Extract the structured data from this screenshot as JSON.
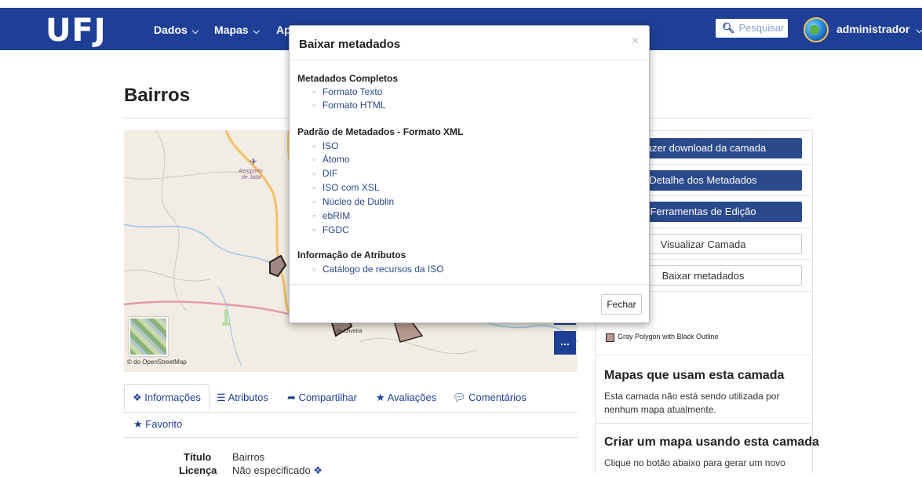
{
  "header": {
    "logo": "UFJ",
    "nav": [
      {
        "label": "Dados"
      },
      {
        "label": "Mapas"
      },
      {
        "label": "Ap"
      }
    ],
    "search_placeholder": "Pesquisar",
    "username": "administrador"
  },
  "page": {
    "title": "Bairros",
    "map_labels": {
      "airport": "Aeroporto de Jataí",
      "place": "de Oliveira",
      "credit": "© do OpenStreetMap"
    },
    "map_more_button": "...",
    "tabs": [
      {
        "icon": "info-icon",
        "label": "Informações"
      },
      {
        "icon": "list-icon",
        "label": "Atributos"
      },
      {
        "icon": "share-icon",
        "label": "Compartilhar"
      },
      {
        "icon": "star-icon",
        "label": "Avaliações"
      },
      {
        "icon": "comment-icon",
        "label": "Comentários"
      },
      {
        "icon": "star-icon",
        "label": "Favorito"
      }
    ],
    "info": [
      {
        "label": "Título",
        "value": "Bairros"
      },
      {
        "label": "Licença",
        "value": "Não especificado"
      }
    ]
  },
  "sidebar": {
    "buttons": [
      {
        "label": "Fazer download da camada",
        "style": "primary"
      },
      {
        "label": "Detalhe dos Metadados",
        "style": "primary"
      },
      {
        "label": "Ferramentas de Edição",
        "style": "primary"
      },
      {
        "label": "Visualizar Camada",
        "style": "default"
      },
      {
        "label": "Baixar metadados",
        "style": "default"
      }
    ],
    "legend_label": "Gray Polygon with Black Outline",
    "maps_heading": "Mapas que usam esta camada",
    "maps_text": "Esta camada não está sendo utilizada por nenhum mapa atualmente.",
    "create_heading": "Criar um mapa usando esta camada",
    "create_text": "Clique no botão abaixo para gerar um novo"
  },
  "modal": {
    "title": "Baixar metadados",
    "close": "×",
    "sections": [
      {
        "heading": "Metadados Completos",
        "links": [
          "Formato Texto",
          "Formato HTML"
        ]
      },
      {
        "heading": "Padrão de Metadados - Formato XML",
        "links": [
          "ISO",
          "Átomo",
          "DIF",
          "ISO com XSL",
          "Núcleo de Dublin",
          "ebRIM",
          "FGDC"
        ]
      },
      {
        "heading": "Informação de Atributos",
        "links": [
          "Catálogo de recursos da ISO"
        ]
      }
    ],
    "close_button": "Fechar"
  },
  "colors": {
    "navbar": "#1f3f96",
    "primary_button": "#2b4a8b",
    "link": "#2b4a8b"
  }
}
